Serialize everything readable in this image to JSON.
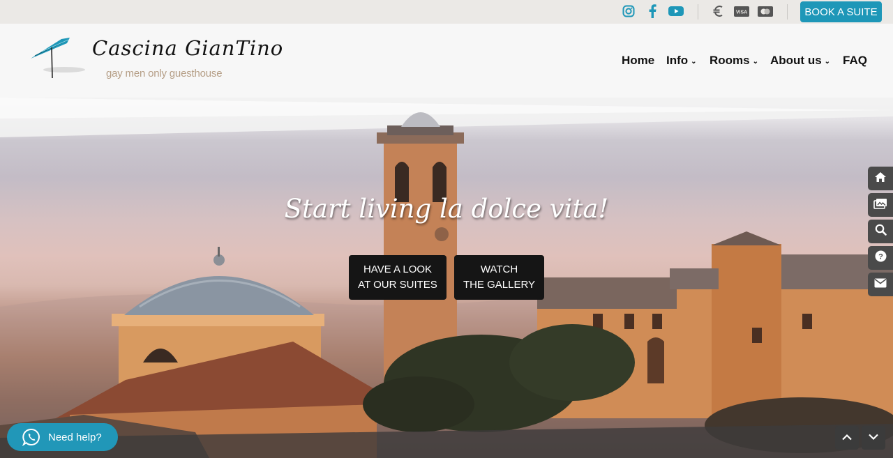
{
  "topbar": {
    "icons": [
      "instagram-icon",
      "facebook-icon",
      "youtube-icon",
      "euro-icon",
      "visa-card-icon",
      "mastercard-icon"
    ],
    "book_label": "BOOK A SUITE"
  },
  "brand": {
    "title": "Cascina GianTino",
    "subtitle": "gay men only guesthouse"
  },
  "nav": {
    "home": "Home",
    "info": "Info",
    "rooms": "Rooms",
    "about": "About us",
    "faq": "FAQ"
  },
  "hero": {
    "slogan": "Start living la dolce vita!",
    "cta_suites_line1": "HAVE A LOOK",
    "cta_suites_line2": "AT OUR SUITES",
    "cta_gallery_line1": "WATCH",
    "cta_gallery_line2": "THE GALLERY"
  },
  "side_bar": [
    "home-icon",
    "gallery-icon",
    "search-icon",
    "help-icon",
    "mail-icon"
  ],
  "help": {
    "label": "Need help?"
  },
  "colors": {
    "accent": "#1e97b8",
    "dark_button": "#151515",
    "subtitle": "#b59e86"
  }
}
